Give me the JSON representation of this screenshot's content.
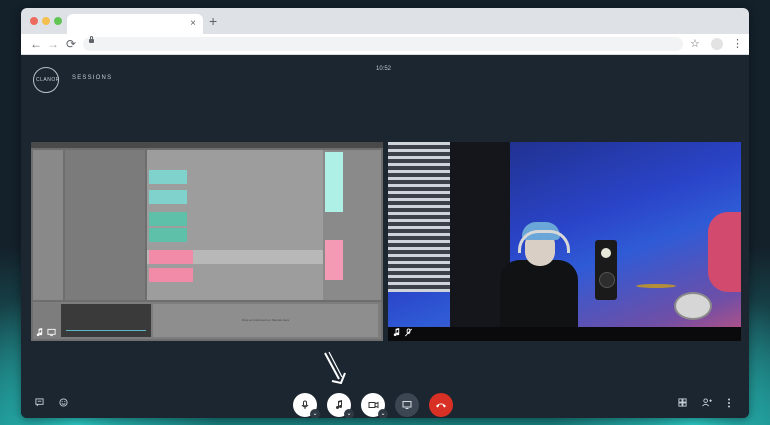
{
  "browser": {
    "tab_close": "×",
    "new_tab": "+",
    "nav_back": "←",
    "nav_forward": "→",
    "nav_reload": "⟳",
    "star": "☆",
    "menu": "⋮"
  },
  "app": {
    "logo_text": "CLANOR",
    "brand": "SESSIONS",
    "time": "10:52"
  },
  "daw": {
    "drop_text": "Drop an Instrument or Sample Here"
  },
  "controls": {
    "caret": "⌄"
  },
  "colors": {
    "accent_red": "#d93025",
    "bg_dark": "#1b2630",
    "teal": "#2cc9c4"
  }
}
